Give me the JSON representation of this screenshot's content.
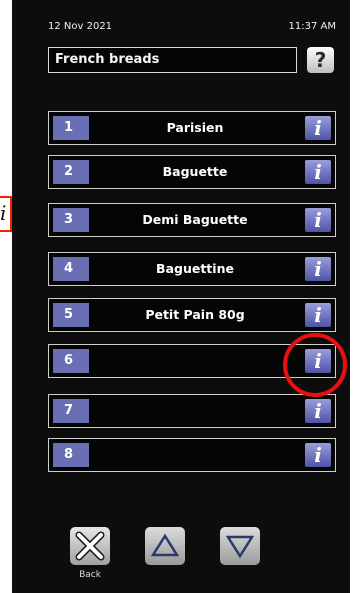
{
  "status": {
    "date": "12 Nov 2021",
    "time": "11:37 AM"
  },
  "header": {
    "title": "French breads",
    "help_icon": "question-mark-icon",
    "help_label": "?"
  },
  "programs": [
    {
      "number": "1",
      "label": "Parisien"
    },
    {
      "number": "2",
      "label": "Baguette"
    },
    {
      "number": "3",
      "label": "Demi Baguette"
    },
    {
      "number": "4",
      "label": "Baguettine"
    },
    {
      "number": "5",
      "label": "Petit Pain 80g"
    },
    {
      "number": "6",
      "label": ""
    },
    {
      "number": "7",
      "label": ""
    },
    {
      "number": "8",
      "label": ""
    }
  ],
  "info_glyph": "i",
  "annotation": {
    "text": "i"
  },
  "footer": {
    "back_label": "Back"
  },
  "colors": {
    "accent": "#6a6eb3",
    "highlight": "#e81010"
  }
}
